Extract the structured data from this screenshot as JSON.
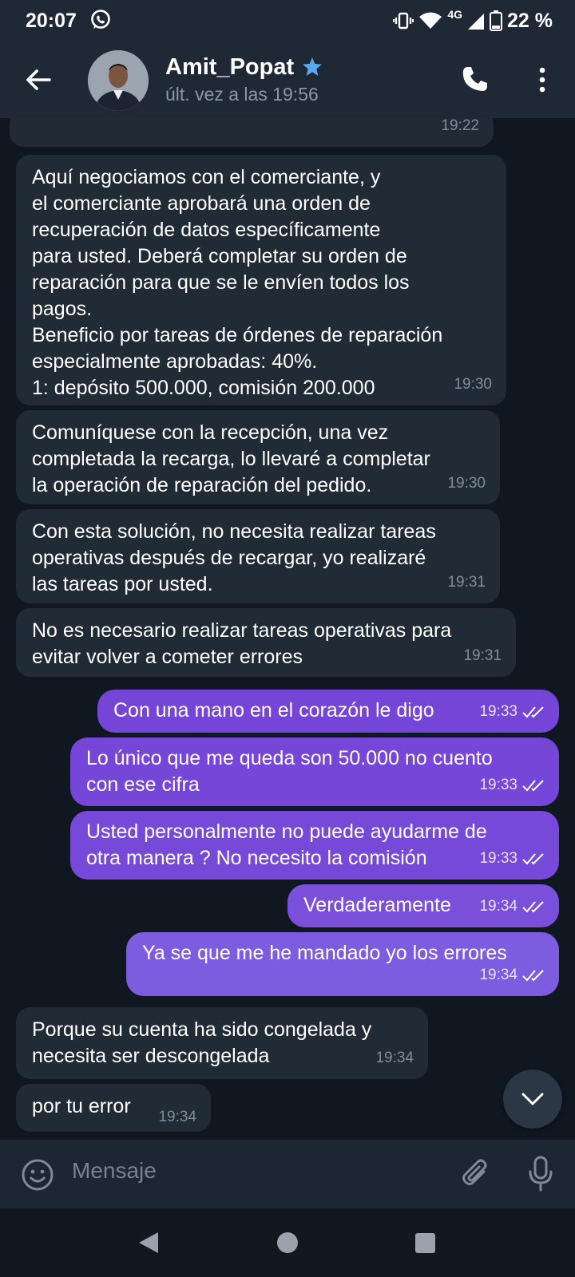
{
  "status_bar": {
    "time": "20:07",
    "network": "4G",
    "battery": "22 %"
  },
  "header": {
    "back_icon": "arrow-left-icon",
    "contact_name": "Amit_Popat",
    "verified_icon": "star-icon",
    "last_seen": "últ. vez a las 19:56",
    "call_icon": "phone-icon",
    "menu_icon": "more-vertical-icon"
  },
  "messages": [
    {
      "dir": "in",
      "text": "",
      "time": "19:22"
    },
    {
      "dir": "in",
      "text": "Aquí negociamos con el comerciante, y\nel comerciante aprobará una orden de\nrecuperación de datos específicamente\npara usted. Deberá completar su orden de\nreparación para que se le envíen todos los\npagos.\nBeneficio por tareas de órdenes de reparación\nespecialmente aprobadas: 40%.\n1: depósito 500.000, comisión 200.000",
      "time": "19:30"
    },
    {
      "dir": "in",
      "text": "Comuníquese con la recepción, una vez\ncompletada la recarga, lo llevaré a completar\nla operación de reparación del pedido.",
      "time": "19:30"
    },
    {
      "dir": "in",
      "text": "Con esta solución, no necesita realizar tareas\noperativas después de recargar, yo realizaré\nlas tareas por usted.",
      "time": "19:31"
    },
    {
      "dir": "in",
      "text": "No es necesario realizar tareas operativas para\nevitar volver a cometer errores",
      "time": "19:31"
    },
    {
      "dir": "out",
      "text": "Con una mano en el corazón le digo",
      "time": "19:33"
    },
    {
      "dir": "out",
      "text": "Lo único que me queda son 50.000 no cuento\ncon ese cifra",
      "time": "19:33"
    },
    {
      "dir": "out",
      "text": "Usted personalmente no puede ayudarme de\notra manera ? No necesito la comisión",
      "time": "19:33"
    },
    {
      "dir": "out",
      "text": "Verdaderamente",
      "time": "19:34"
    },
    {
      "dir": "out",
      "text": "Ya se que me he mandado yo los errores",
      "time": "19:34"
    },
    {
      "dir": "in",
      "text": "Porque su cuenta ha sido congelada y\nnecesita ser descongelada",
      "time": "19:34"
    },
    {
      "dir": "in",
      "text": "por tu error",
      "time": "19:34"
    }
  ],
  "scroll_down_icon": "chevron-down-icon",
  "input": {
    "placeholder": "Mensaje",
    "emoji_icon": "smiley-icon",
    "attach_icon": "paperclip-icon",
    "mic_icon": "microphone-icon"
  },
  "colors": {
    "background": "#0f1721",
    "header": "#1f2935",
    "incoming_bubble": "#202b36",
    "outgoing_bubble": "#7a47d9",
    "accent": "#5aa9f0"
  }
}
